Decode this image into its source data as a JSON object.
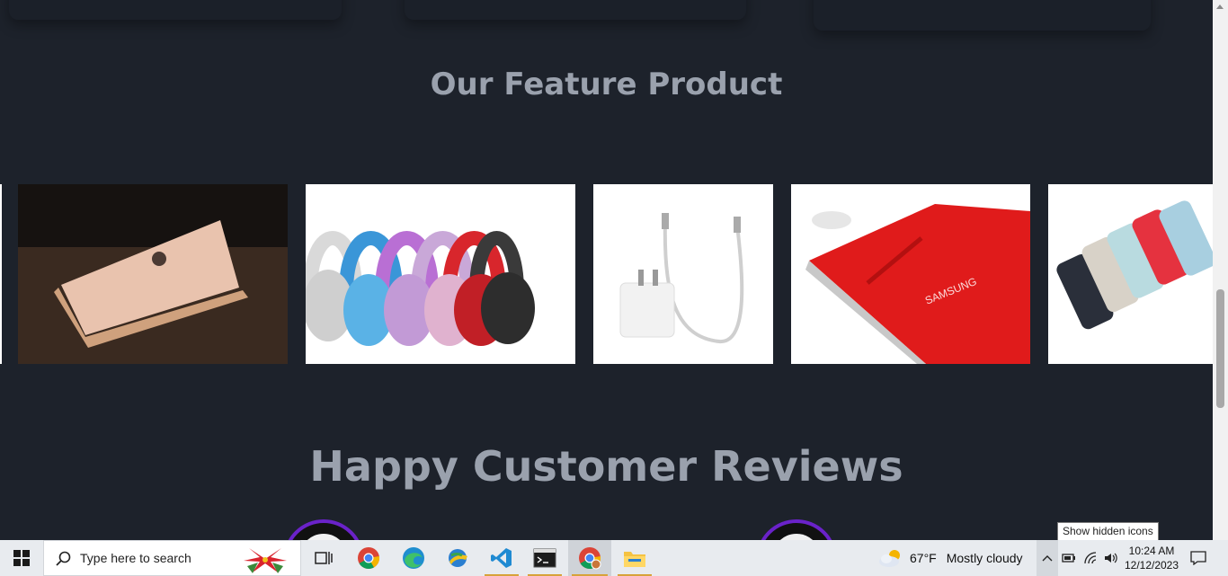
{
  "sections": {
    "featured": {
      "title": "Our Feature Product"
    },
    "reviews": {
      "title": "Happy Customer Reviews"
    }
  },
  "products": [
    {
      "name": "laptop-image"
    },
    {
      "name": "headphones-image"
    },
    {
      "name": "charger-image"
    },
    {
      "name": "tablet-image"
    },
    {
      "name": "phones-image"
    }
  ],
  "taskbar": {
    "search_placeholder": "Type here to search",
    "weather_temp": "67°F",
    "weather_text": "Mostly cloudy",
    "time": "10:24 AM",
    "date": "12/12/2023",
    "tooltip": "Show hidden icons"
  },
  "colors": {
    "background": "#1d222b",
    "heading": "#9aa1ad",
    "avatar_ring": "#6a22c9"
  }
}
